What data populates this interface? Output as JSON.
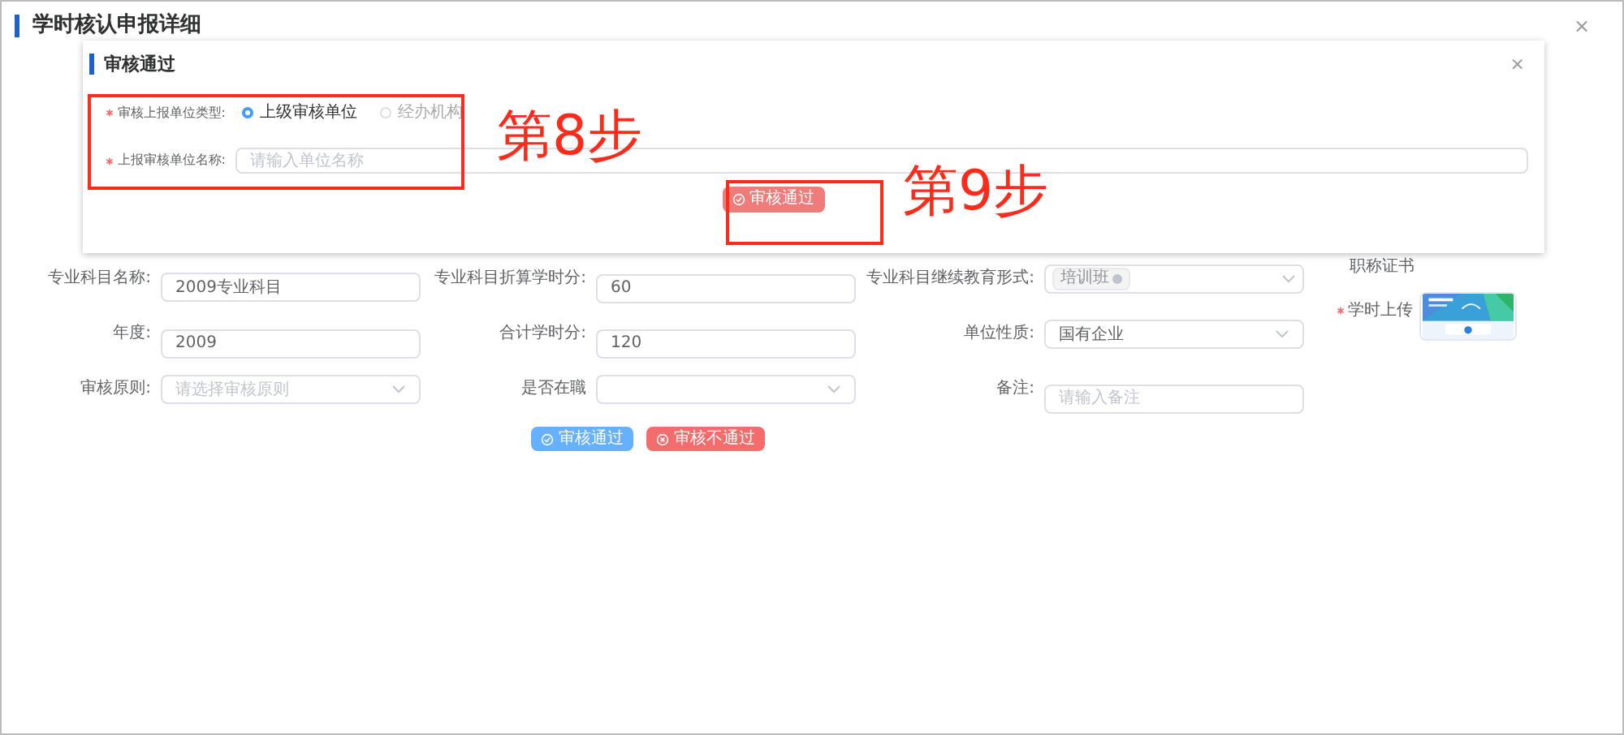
{
  "page": {
    "title": "学时核认申报详细",
    "close": "×"
  },
  "form": {
    "fields": [
      {
        "label": "专业科目名称:",
        "kind": "input",
        "value": "2009专业科目"
      },
      {
        "label": "专业科目折算学时分:",
        "kind": "input",
        "value": "60"
      },
      {
        "label": "专业科目继续教育形式:",
        "kind": "tags",
        "tags": [
          "培训班"
        ]
      },
      {
        "label": "年度:",
        "kind": "input",
        "value": "2009"
      },
      {
        "label": "合计学时分:",
        "kind": "input",
        "value": "120"
      },
      {
        "label": "单位性质:",
        "kind": "select",
        "value": "国有企业"
      },
      {
        "label": "审核原则:",
        "kind": "select",
        "placeholder": "请选择审核原则"
      },
      {
        "label": "是否在職",
        "kind": "select"
      },
      {
        "label": "备注:",
        "kind": "input",
        "placeholder": "请输入备注"
      }
    ],
    "side": {
      "certificate_label": "职称证书",
      "upload_label": "学时上传",
      "upload_required": true
    },
    "buttons": [
      {
        "label": "审核通过",
        "kind": "primary"
      },
      {
        "label": "审核不通过",
        "kind": "danger"
      }
    ]
  },
  "modal": {
    "title": "审核通过",
    "close": "×",
    "fields": [
      {
        "label": "审核上报单位类型:",
        "required": true,
        "kind": "radio",
        "options": [
          {
            "label": "上级审核单位",
            "selected": true
          },
          {
            "label": "经办机构",
            "selected": false
          }
        ]
      },
      {
        "label": "上报审核单位名称:",
        "required": true,
        "kind": "input",
        "placeholder": "请输入单位名称"
      }
    ],
    "button": "审核通过"
  },
  "annotations": [
    "第8步",
    "第9步"
  ]
}
